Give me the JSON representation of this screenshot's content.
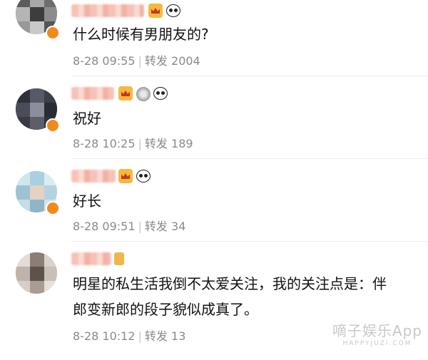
{
  "comments": [
    {
      "text": "什么时候有男朋友的?",
      "date": "8-28 09:55",
      "repost_label": "转发",
      "repost_count": "2004",
      "badges": [
        "crown-icon",
        "panda-icon"
      ]
    },
    {
      "text": "祝好",
      "date": "8-28 10:25",
      "repost_label": "转发",
      "repost_count": "189",
      "badges": [
        "crown-icon",
        "medal-icon",
        "panda-icon"
      ]
    },
    {
      "text": "好长",
      "date": "8-28 09:51",
      "repost_label": "转发",
      "repost_count": "34",
      "badges": [
        "crown-icon",
        "panda-icon"
      ]
    },
    {
      "text_line1": "明星的私生活我倒不太爱关注，我的关注点是：伴",
      "text_line2": "郎变新郎的段子貌似成真了。",
      "date": "8-28 10:12",
      "repost_label": "转发",
      "repost_count": "13",
      "badges": [
        "rank-icon"
      ]
    }
  ],
  "separator": "|",
  "watermark": {
    "main": "嘀子娱乐App",
    "sub": "HAPPYJUZI.COM"
  },
  "colors": {
    "meta": "#8a8a8a",
    "badge_orange": "#f08a1d",
    "name_blur": "#f6c2b8"
  }
}
